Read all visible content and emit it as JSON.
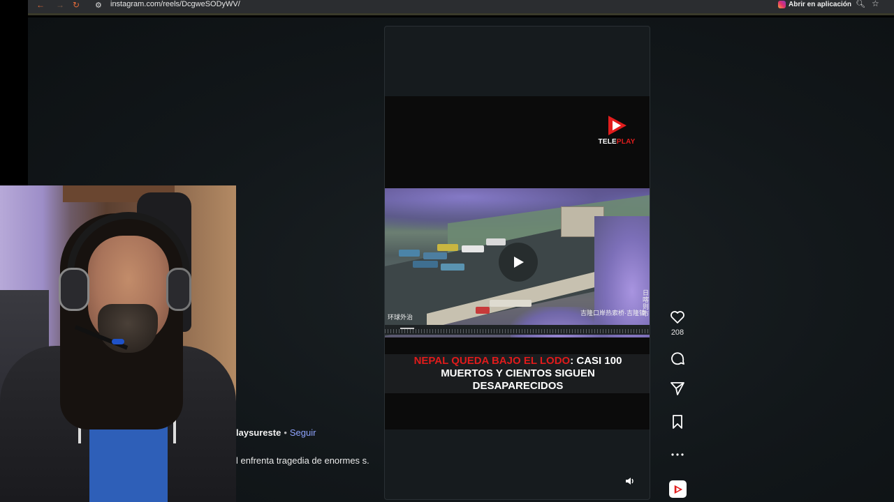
{
  "browser": {
    "url": "instagram.com/reels/DcgweSODyWV/",
    "open_app_label": "Abrir en aplicación",
    "icons": {
      "back": "back-arrow-icon",
      "forward": "forward-arrow-icon",
      "reload": "reload-icon",
      "site_settings": "site-settings-icon",
      "zoom": "zoom-icon",
      "bookmark": "star-icon"
    }
  },
  "reel": {
    "logo": {
      "text_main": "TELE",
      "text_accent": "PLAY"
    },
    "video": {
      "watermark_left": "环球外治",
      "watermark_right": "吉隆口岸热索桥·吉隆镇",
      "watermark_vertical": "日喀则市",
      "state": "paused"
    },
    "headline": {
      "red_part": "NEPAL QUEDA BAJO EL LODO",
      "white_part": ": CASI 100 MUERTOS Y CIENTOS SIGUEN DESAPARECIDOS"
    },
    "volume_icon": "volume-icon"
  },
  "actions": {
    "like_count": "208",
    "icons": [
      "heart-icon",
      "comment-icon",
      "share-icon",
      "bookmark-icon",
      "more-icon"
    ]
  },
  "post": {
    "author": "laysureste",
    "separator": "•",
    "follow_label": "Seguir",
    "caption": "l enfrenta tragedia de enormes s."
  },
  "colors": {
    "accent_red": "#e01b1b",
    "follow_blue": "#8fa4ff",
    "page_bg": "#12171a"
  }
}
